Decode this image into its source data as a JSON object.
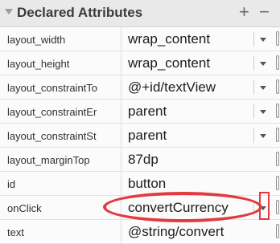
{
  "panel": {
    "title": "Declared Attributes",
    "add_icon": "plus-icon",
    "remove_icon": "minus-icon",
    "add_glyph": "+",
    "remove_glyph": "−"
  },
  "attributes": [
    {
      "name": "layout_width",
      "value": "wrap_content",
      "has_dropdown": true
    },
    {
      "name": "layout_height",
      "value": "wrap_content",
      "has_dropdown": true
    },
    {
      "name": "layout_constraintTo",
      "value": "@+id/textView",
      "has_dropdown": true
    },
    {
      "name": "layout_constraintEr",
      "value": "parent",
      "has_dropdown": true
    },
    {
      "name": "layout_constraintSt",
      "value": "parent",
      "has_dropdown": true
    },
    {
      "name": "layout_marginTop",
      "value": "87dp",
      "has_dropdown": false
    },
    {
      "name": "id",
      "value": "button",
      "has_dropdown": false
    },
    {
      "name": "onClick",
      "value": "convertCurrency",
      "has_dropdown": true,
      "highlighted": true
    },
    {
      "name": "text",
      "value": "@string/convert",
      "has_dropdown": false
    }
  ],
  "highlight_color": "#e23a3f"
}
